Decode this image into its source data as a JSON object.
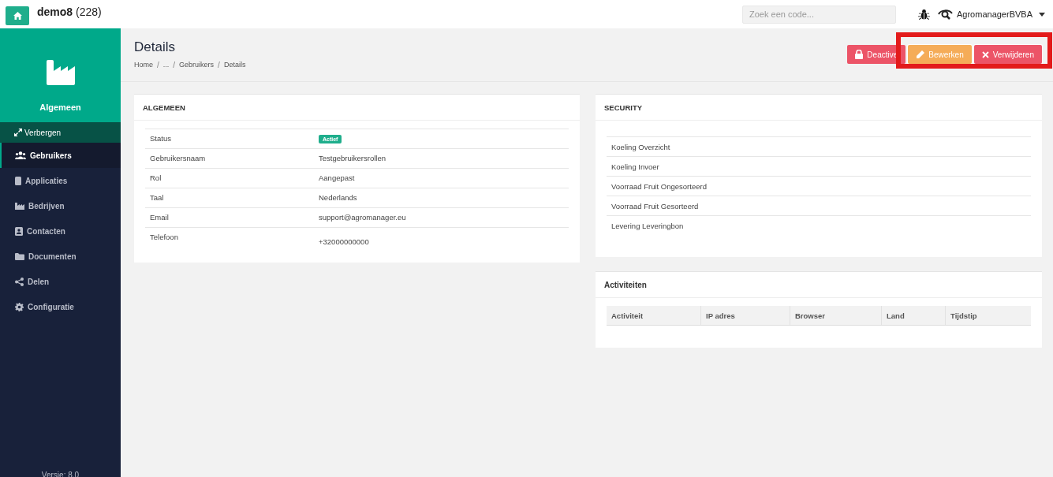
{
  "topbar": {
    "app_name": "demo8",
    "count": "(228)",
    "search": {
      "placeholder": "Zoek een code..."
    },
    "user": "AgromanagerBVBA"
  },
  "sidebar": {
    "section": "Algemeen",
    "toggle": "Verbergen",
    "items": [
      {
        "label": "Gebruikers",
        "kind": "users",
        "selected": true
      },
      {
        "label": "Applicaties",
        "kind": "phone",
        "selected": false
      },
      {
        "label": "Bedrijven",
        "kind": "factory",
        "selected": false
      },
      {
        "label": "Contacten",
        "kind": "contact",
        "selected": false
      },
      {
        "label": "Documenten",
        "kind": "folder",
        "selected": false
      },
      {
        "label": "Delen",
        "kind": "share",
        "selected": false
      },
      {
        "label": "Configuratie",
        "kind": "gear",
        "selected": false
      }
    ],
    "version": "Versie: 8.0"
  },
  "header": {
    "title": "Details",
    "breadcrumb": [
      {
        "text": "Home",
        "kind": "link"
      },
      {
        "text": "/",
        "kind": "separator"
      },
      {
        "text": "...",
        "kind": "link"
      },
      {
        "text": "/",
        "kind": "separator"
      },
      {
        "text": "Gebruikers",
        "kind": "link"
      },
      {
        "text": "/",
        "kind": "separator"
      },
      {
        "text": "Details",
        "kind": "current"
      }
    ]
  },
  "actions": {
    "highlighted": true,
    "buttons": [
      {
        "label": "Deactive",
        "kind": "lock",
        "highlighted": false
      },
      {
        "label": "Bewerken",
        "kind": "edit",
        "highlighted": true
      },
      {
        "label": "Verwijderen",
        "kind": "delete",
        "highlighted": true
      }
    ]
  },
  "general": {
    "title": "ALGEMEEN",
    "rows": [
      {
        "label": "Status",
        "value": "Actief",
        "kind": "badge"
      },
      {
        "label": "Gebruikersnaam",
        "value": "Testgebruikersrollen",
        "kind": "text"
      },
      {
        "label": "Rol",
        "value": "Aangepast",
        "kind": "text"
      },
      {
        "label": "Taal",
        "value": "Nederlands",
        "kind": "text"
      },
      {
        "label": "Email",
        "value": "support@agromanager.eu",
        "kind": "text"
      },
      {
        "label": "Telefoon",
        "value": "+32000000000",
        "kind": "text"
      }
    ]
  },
  "security": {
    "title": "SECURITY",
    "items": [
      "Koeling Overzicht",
      "Koeling Invoer",
      "Voorraad Fruit Ongesorteerd",
      "Voorraad Fruit Gesorteerd",
      "Levering Leveringbon"
    ]
  },
  "activities": {
    "title": "Activiteiten",
    "columns": [
      "Activiteit",
      "IP adres",
      "Browser",
      "Land",
      "Tijdstip"
    ]
  }
}
